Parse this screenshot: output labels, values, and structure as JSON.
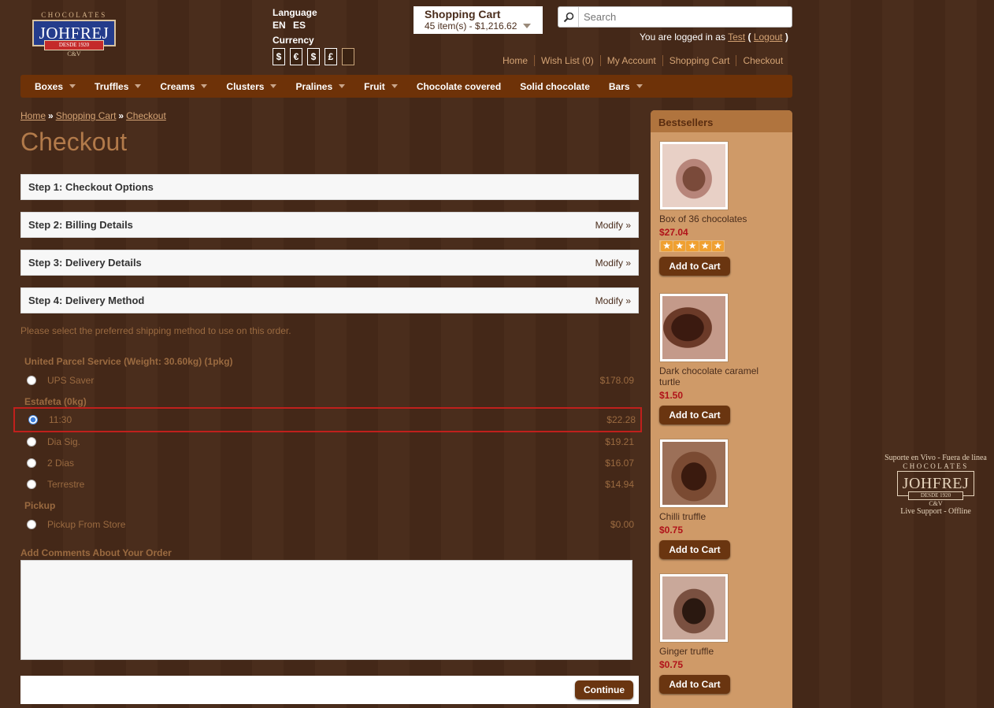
{
  "logo": {
    "top": "CHOCOLATES",
    "brand": "JOHFREJ",
    "ribbon": "DESDE 1920",
    "cv": "C&V"
  },
  "language": {
    "label": "Language",
    "codes": [
      "EN",
      "ES"
    ]
  },
  "currency": {
    "label": "Currency",
    "options": [
      "$",
      "€",
      "$",
      "£",
      ""
    ]
  },
  "cart": {
    "title": "Shopping Cart",
    "summary": "45 item(s) - $1,216.62"
  },
  "search": {
    "placeholder": "Search"
  },
  "login": {
    "prefix": "You are logged in as",
    "user": "Test",
    "open": "(",
    "logout": "Logout",
    "close": ")"
  },
  "toplinks": [
    "Home",
    "Wish List (0)",
    "My Account",
    "Shopping Cart",
    "Checkout"
  ],
  "menu": [
    {
      "label": "Boxes",
      "dropdown": true
    },
    {
      "label": "Truffles",
      "dropdown": true
    },
    {
      "label": "Creams",
      "dropdown": true
    },
    {
      "label": "Clusters",
      "dropdown": true
    },
    {
      "label": "Pralines",
      "dropdown": true
    },
    {
      "label": "Fruit",
      "dropdown": true
    },
    {
      "label": "Chocolate covered",
      "dropdown": false
    },
    {
      "label": "Solid chocolate",
      "dropdown": false
    },
    {
      "label": "Bars",
      "dropdown": true
    }
  ],
  "breadcrumb": [
    "Home",
    "Shopping Cart",
    "Checkout"
  ],
  "breadcrumb_sep": "»",
  "page_title": "Checkout",
  "steps": [
    {
      "title": "Step 1: Checkout Options",
      "modify": ""
    },
    {
      "title": "Step 2: Billing Details",
      "modify": "Modify »"
    },
    {
      "title": "Step 3: Delivery Details",
      "modify": "Modify »"
    },
    {
      "title": "Step 4: Delivery Method",
      "modify": "Modify »"
    }
  ],
  "shipping_note": "Please select the preferred shipping method to use on this order.",
  "shipping_groups": [
    {
      "title": "United Parcel Service (Weight: 30.60kg) (1pkg)",
      "options": [
        {
          "name": "UPS Saver",
          "price": "$178.09",
          "selected": false
        }
      ]
    },
    {
      "title": "Estafeta (0kg)",
      "options": [
        {
          "name": "11:30",
          "price": "$22.28",
          "selected": true
        },
        {
          "name": "Dia Sig.",
          "price": "$19.21",
          "selected": false
        },
        {
          "name": "2 Dias",
          "price": "$16.07",
          "selected": false
        },
        {
          "name": "Terrestre",
          "price": "$14.94",
          "selected": false
        }
      ]
    },
    {
      "title": "Pickup",
      "options": [
        {
          "name": "Pickup From Store",
          "price": "$0.00",
          "selected": false
        }
      ]
    }
  ],
  "comments_label": "Add Comments About Your Order",
  "continue_label": "Continue",
  "sidebar": {
    "title": "Bestsellers",
    "products": [
      {
        "name": "Box of 36 chocolates",
        "price": "$27.04",
        "rating": 5,
        "add": "Add to Cart"
      },
      {
        "name": "Dark chocolate caramel turtle",
        "price": "$1.50",
        "rating": 0,
        "add": "Add to Cart"
      },
      {
        "name": "Chilli truffle",
        "price": "$0.75",
        "rating": 0,
        "add": "Add to Cart"
      },
      {
        "name": "Ginger truffle",
        "price": "$0.75",
        "rating": 0,
        "add": "Add to Cart"
      }
    ]
  },
  "support": {
    "line1": "Suporte en Vivo - Fuera de linea",
    "top": "CHOCOLATES",
    "brand": "JOHFREJ",
    "ribbon": "DESDE 1920",
    "cv": "C&V",
    "line2": "Live Support - Offline"
  }
}
